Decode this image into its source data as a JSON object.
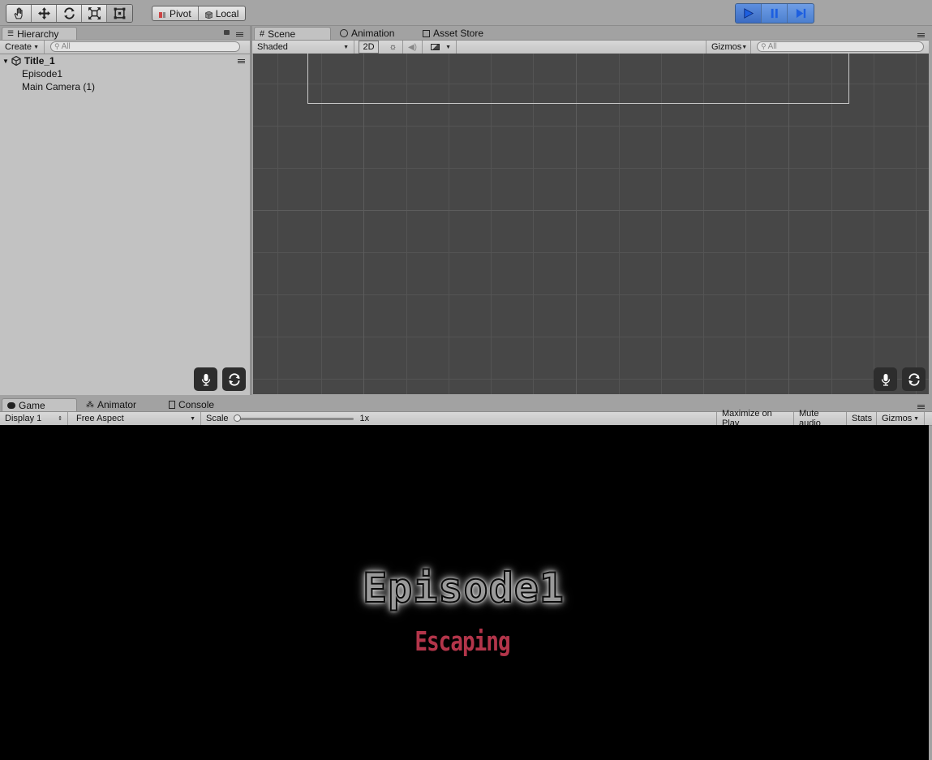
{
  "toolbar": {
    "tools": [
      "hand-tool-icon",
      "move-tool-icon",
      "rotate-tool-icon",
      "scale-tool-icon",
      "rect-tool-icon"
    ],
    "pivot_label": "Pivot",
    "local_label": "Local",
    "play_controls": [
      "play-icon",
      "pause-icon",
      "step-icon"
    ],
    "accent": "#3f7ef0"
  },
  "hierarchy": {
    "tab_label": "Hierarchy",
    "create_label": "Create",
    "search_placeholder": "All",
    "scene_name": "Title_1",
    "items": [
      "Episode1",
      "Main Camera (1)"
    ]
  },
  "scene_panel": {
    "tabs": [
      "Scene",
      "Animation",
      "Asset Store"
    ],
    "shading_mode": "Shaded",
    "mode_2d": "2D",
    "gizmos_label": "Gizmos",
    "search_placeholder": "All"
  },
  "game_panel": {
    "tabs": [
      "Game",
      "Animator",
      "Console"
    ],
    "display": "Display 1",
    "aspect": "Free Aspect",
    "scale_label": "Scale",
    "scale_value": "1x",
    "maximize_label": "Maximize on Play",
    "mute_label": "Mute audio",
    "stats_label": "Stats",
    "gizmos_label": "Gizmos",
    "title_text": "Episode1",
    "subtitle_text": "Escaping",
    "subtitle_color": "#b3354a"
  }
}
